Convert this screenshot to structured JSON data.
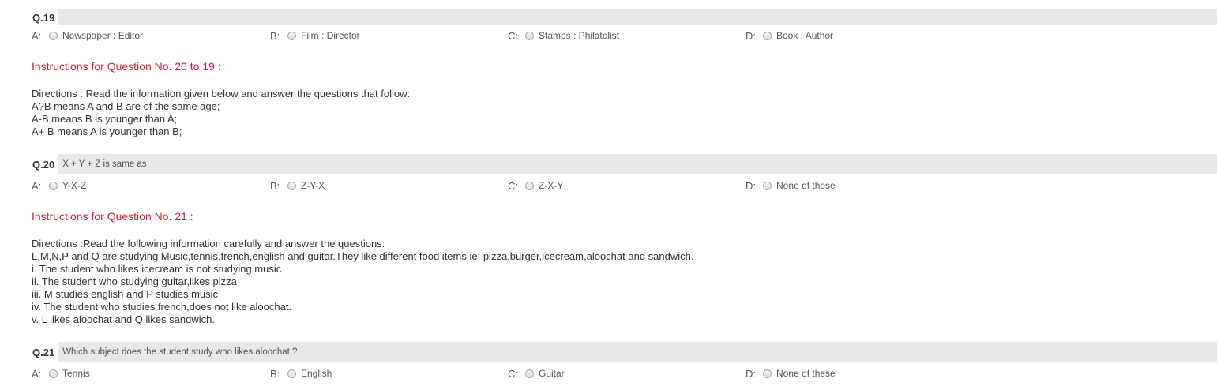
{
  "questions": [
    {
      "number": "Q.19",
      "text": "",
      "options": [
        {
          "letter": "A:",
          "text": "Newspaper : Editor"
        },
        {
          "letter": "B:",
          "text": "Film : Director"
        },
        {
          "letter": "C:",
          "text": "Stamps : Philatelist"
        },
        {
          "letter": "D:",
          "text": "Book : Author"
        }
      ]
    },
    {
      "number": "Q.20",
      "text": "X + Y + Z is same as",
      "options": [
        {
          "letter": "A:",
          "text": "Y-X-Z"
        },
        {
          "letter": "B:",
          "text": "Z-Y-X"
        },
        {
          "letter": "C:",
          "text": "Z-X-Y"
        },
        {
          "letter": "D:",
          "text": "None of these"
        }
      ]
    },
    {
      "number": "Q.21",
      "text": "Which subject does the student study who likes aloochat ?",
      "options": [
        {
          "letter": "A:",
          "text": "Tennis"
        },
        {
          "letter": "B:",
          "text": "English"
        },
        {
          "letter": "C:",
          "text": "Guitar"
        },
        {
          "letter": "D:",
          "text": "None of these"
        }
      ]
    }
  ],
  "instructions": [
    {
      "title": "Instructions for Question No. 20 to 19 :",
      "lines": [
        "Directions : Read the information given below and answer the questions that follow:",
        "A?B means A and B are of the same age;",
        "A-B means B is younger than A;",
        "A+ B means A is younger than B;"
      ]
    },
    {
      "title": "Instructions for Question No. 21 :",
      "lines": [
        "Directions :Read the following information carefully and answer the questions:",
        "L,M,N,P and Q are studying Music,tennis,french,english and guitar.They like different food items ie: pizza,burger,icecream,aloochat and sandwich.",
        "i. The student who likes icecream is not studying music",
        "ii. The student who studying guitar,likes pizza",
        "iii. M studies english and P studies music",
        "iv. The student who studies french,does not like aloochat.",
        "v. L likes aloochat and Q likes sandwich."
      ]
    }
  ],
  "colors": {
    "instruction_title": "#d2202f",
    "question_bar": "#e8e8e8",
    "radio_border": "#a8a8a8"
  }
}
